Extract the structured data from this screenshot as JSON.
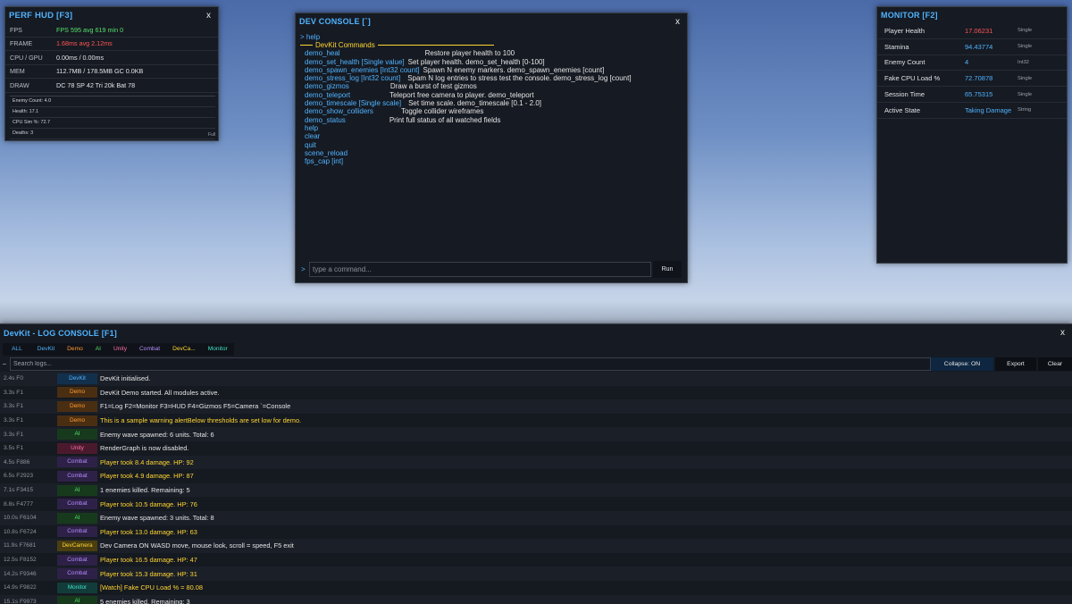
{
  "perf_hud": {
    "title": "PERF HUD [F3]",
    "close": "x",
    "rows": [
      {
        "label": "FPS",
        "value": "FPS  595  avg 619  min 0",
        "tone": "green"
      },
      {
        "label": "FRAME",
        "value": "1.68ms  avg 2.12ms",
        "tone": "red"
      },
      {
        "label": "CPU / GPU",
        "value": "0.00ms  /  0.00ms",
        "tone": "white"
      },
      {
        "label": "MEM",
        "value": "112.7MB / 178.5MB  GC 0.0KB",
        "tone": "white"
      },
      {
        "label": "DRAW",
        "value": "DC 78  SP 42  Tri 20k  Bat 78",
        "tone": "white"
      }
    ],
    "stats": [
      "Enemy Count: 4.0",
      "Health: 17.1",
      "CPU Sim %: 72.7",
      "Deaths: 3"
    ],
    "footer": "Full"
  },
  "dev_console": {
    "title": "DEV CONSOLE [`]",
    "close": "x",
    "echo": "> help",
    "header": "DevKit Commands",
    "commands": [
      {
        "cmd": "demo_heal",
        "desc": "Restore player health to 100",
        "pad": 91
      },
      {
        "cmd": "demo_set_health [Single value]",
        "desc": "Set player health. demo_set_health [0-100]",
        "pad": 0
      },
      {
        "cmd": "demo_spawn_enemies [Int32 count]",
        "desc": "Spawn N enemy markers. demo_spawn_enemies [count]",
        "pad": 0
      },
      {
        "cmd": "demo_stress_log [Int32 count]",
        "desc": "Spam N log entries to stress test the console. demo_stress_log [count]",
        "pad": 4
      },
      {
        "cmd": "demo_gizmos",
        "desc": "Draw a burst of test gizmos",
        "pad": 42
      },
      {
        "cmd": "demo_teleport",
        "desc": "Teleport free camera to player. demo_teleport",
        "pad": 40
      },
      {
        "cmd": "demo_timescale [Single scale]",
        "desc": "Set time scale. demo_timescale [0.1 - 2.0]",
        "pad": 4
      },
      {
        "cmd": "demo_show_colliders",
        "desc": "Toggle collider wireframes",
        "pad": 27
      },
      {
        "cmd": "demo_status",
        "desc": "Print full status of all watched fields",
        "pad": 45
      },
      {
        "cmd": "help",
        "desc": "",
        "pad": 0
      },
      {
        "cmd": "clear",
        "desc": "",
        "pad": 0
      },
      {
        "cmd": "quit",
        "desc": "",
        "pad": 0
      },
      {
        "cmd": "scene_reload",
        "desc": "",
        "pad": 0
      },
      {
        "cmd": "fps_cap [int]",
        "desc": "",
        "pad": 0
      }
    ],
    "prompt": ">",
    "input_value": "",
    "input_placeholder": "type a command...",
    "run_label": "Run"
  },
  "monitor": {
    "title": "MONITOR [F2]",
    "fields": [
      {
        "name": "Player Health",
        "value": "17.06231",
        "type": "Single",
        "tone": "red"
      },
      {
        "name": "Stamina",
        "value": "94.43774",
        "type": "Single",
        "tone": "blue"
      },
      {
        "name": "Enemy Count",
        "value": "4",
        "type": "Int32",
        "tone": "blue"
      },
      {
        "name": "Fake CPU Load %",
        "value": "72.70878",
        "type": "Single",
        "tone": "blue"
      },
      {
        "name": "Session Time",
        "value": "65.75315",
        "type": "Single",
        "tone": "blue"
      },
      {
        "name": "Active State",
        "value": "Taking Damage",
        "type": "String",
        "tone": "blue"
      }
    ]
  },
  "log_console": {
    "title": "DevKit - LOG CONSOLE [F1]",
    "close": "x",
    "tabs": [
      {
        "label": "ALL",
        "color": "#4fb3ff"
      },
      {
        "label": "DevKit",
        "color": "#4fb3ff"
      },
      {
        "label": "Demo",
        "color": "#ff9b30"
      },
      {
        "label": "AI",
        "color": "#55e06a"
      },
      {
        "label": "Unity",
        "color": "#ff6fb0"
      },
      {
        "label": "Combat",
        "color": "#b58cff"
      },
      {
        "label": "DevCa...",
        "color": "#ffd633"
      },
      {
        "label": "Monitor",
        "color": "#3fe0c8"
      }
    ],
    "minus": "–",
    "search_placeholder": "Search logs...",
    "collapse_label": "Collapse: ON",
    "export_label": "Export",
    "clear_label": "Clear",
    "rows": [
      {
        "time": "2.4s  F0",
        "tag": "DevKit",
        "msg": "DevKit initialised.",
        "level": "info"
      },
      {
        "time": "3.3s  F1",
        "tag": "Demo",
        "msg": "DevKit Demo started. All modules active.",
        "level": "info"
      },
      {
        "time": "3.3s  F1",
        "tag": "Demo",
        "msg": "F1=Log  F2=Monitor  F3=HUD  F4=Gizmos  F5=Camera  `=Console",
        "level": "info"
      },
      {
        "time": "3.3s  F1",
        "tag": "Demo",
        "msg": "This is a sample warning  alertBelow thresholds are set low for demo.",
        "level": "warn"
      },
      {
        "time": "3.3s  F1",
        "tag": "AI",
        "msg": "Enemy wave spawned: 6 units. Total: 6",
        "level": "info"
      },
      {
        "time": "3.5s  F1",
        "tag": "Unity",
        "msg": "RenderGraph is now disabled.",
        "level": "info"
      },
      {
        "time": "4.5s  F886",
        "tag": "Combat",
        "msg": "Player took 8.4 damage. HP: 92",
        "level": "warn"
      },
      {
        "time": "6.5s  F2923",
        "tag": "Combat",
        "msg": "Player took 4.9 damage. HP: 87",
        "level": "warn"
      },
      {
        "time": "7.1s  F3415",
        "tag": "AI",
        "msg": "1 enemies killed. Remaining: 5",
        "level": "info"
      },
      {
        "time": "8.8s  F4777",
        "tag": "Combat",
        "msg": "Player took 10.5 damage. HP: 76",
        "level": "warn"
      },
      {
        "time": "10.0s  F6104",
        "tag": "AI",
        "msg": "Enemy wave spawned: 3 units. Total: 8",
        "level": "info"
      },
      {
        "time": "10.8s  F6724",
        "tag": "Combat",
        "msg": "Player took 13.0 damage. HP: 63",
        "level": "warn"
      },
      {
        "time": "11.9s  F7681",
        "tag": "DevCamera",
        "msg": "Dev Camera ON  WASD move, mouse look, scroll = speed, F5 exit",
        "level": "info"
      },
      {
        "time": "12.5s  F8152",
        "tag": "Combat",
        "msg": "Player took 16.5 damage. HP: 47",
        "level": "warn"
      },
      {
        "time": "14.2s  F9346",
        "tag": "Combat",
        "msg": "Player took 15.3 damage. HP: 31",
        "level": "warn"
      },
      {
        "time": "14.9s  F9822",
        "tag": "Monitor",
        "msg": "[Watch] Fake CPU Load % = 80.08",
        "level": "warn"
      },
      {
        "time": "15.1s  F9973",
        "tag": "AI",
        "msg": "5 enemies killed. Remaining: 3",
        "level": "info"
      }
    ]
  },
  "tag_styles": {
    "DevKit": {
      "bg": "#12304c",
      "fg": "#4fb3ff"
    },
    "Demo": {
      "bg": "#4a2e12",
      "fg": "#ff9b30"
    },
    "AI": {
      "bg": "#173a1d",
      "fg": "#55e06a"
    },
    "Unity": {
      "bg": "#4a1a2c",
      "fg": "#ff6fb0"
    },
    "Combat": {
      "bg": "#2e2147",
      "fg": "#b58cff"
    },
    "DevCamera": {
      "bg": "#4a3e10",
      "fg": "#ffd633"
    },
    "Monitor": {
      "bg": "#123c3a",
      "fg": "#3fe0c8"
    }
  },
  "level_colors": {
    "info": "#e6e6e6",
    "warn": "#ffd633"
  },
  "tone_colors": {
    "green": "#55e06a",
    "red": "#ff5555",
    "white": "#e2e4e8",
    "blue": "#4fb3ff"
  }
}
